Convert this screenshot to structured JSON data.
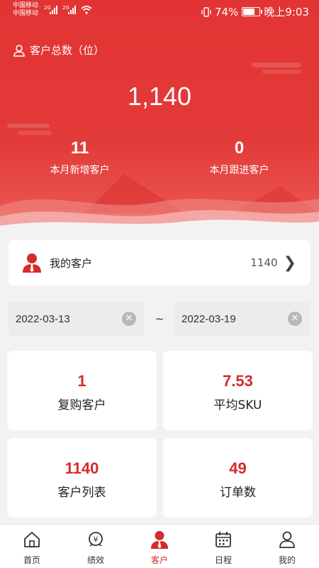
{
  "status_bar": {
    "carrier1": "中国移动",
    "carrier2": "中国移动",
    "net1": "2G",
    "net2": "2G",
    "battery": "74%",
    "battery_level": 0.74,
    "time": "晚上9:03"
  },
  "header": {
    "title": "客户总数（位）",
    "total": "1,140",
    "stats": [
      {
        "value": "11",
        "label": "本月新增客户"
      },
      {
        "value": "0",
        "label": "本月跟进客户"
      }
    ]
  },
  "my_customers": {
    "label": "我的客户",
    "count": "1140"
  },
  "date_range": {
    "start": "2022-03-13",
    "separator": "~",
    "end": "2022-03-19"
  },
  "tiles": [
    {
      "value": "1",
      "label": "复购客户"
    },
    {
      "value": "7.53",
      "label": "平均SKU"
    },
    {
      "value": "1140",
      "label": "客户列表"
    },
    {
      "value": "49",
      "label": "订单数"
    }
  ],
  "tabs": [
    {
      "label": "首页",
      "icon": "home-icon"
    },
    {
      "label": "绩效",
      "icon": "performance-icon"
    },
    {
      "label": "客户",
      "icon": "customer-icon",
      "active": true
    },
    {
      "label": "日程",
      "icon": "calendar-icon"
    },
    {
      "label": "我的",
      "icon": "profile-icon"
    }
  ],
  "colors": {
    "brand": "#e23434",
    "accent_text": "#d52b2b"
  }
}
